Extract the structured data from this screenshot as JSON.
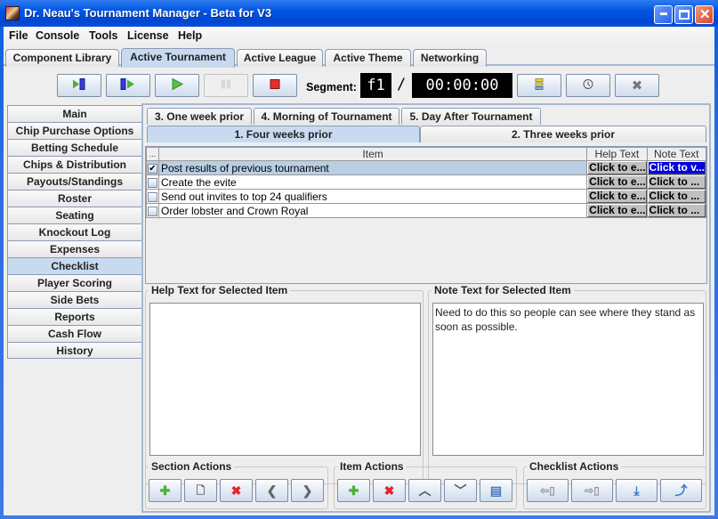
{
  "window": {
    "title": "Dr. Neau's Tournament Manager - Beta for V3",
    "controls": {
      "minimize": "_",
      "maximize": "□",
      "close": "✕"
    }
  },
  "menubar": [
    "File",
    "Console",
    "Tools",
    "License",
    "Help"
  ],
  "top_tabs": [
    {
      "label": "Component Library",
      "active": false
    },
    {
      "label": "Active Tournament",
      "active": true
    },
    {
      "label": "Active League",
      "active": false
    },
    {
      "label": "Active Theme",
      "active": false
    },
    {
      "label": "Networking",
      "active": false
    }
  ],
  "toolbar": {
    "buttons": [
      {
        "name": "skip-to-start",
        "icon": "▶▮",
        "enabled": true
      },
      {
        "name": "skip-to-next",
        "icon": "▮▶",
        "enabled": true
      },
      {
        "name": "play",
        "icon": "▶",
        "enabled": true
      },
      {
        "name": "pause",
        "icon": "▮▮",
        "enabled": false
      },
      {
        "name": "stop",
        "icon": "■",
        "enabled": true
      }
    ],
    "segment_label": "Segment:",
    "segment_value": "f1",
    "separator": "/",
    "timer": "00:00:00",
    "right_buttons": [
      {
        "name": "levels",
        "icon": "≣"
      },
      {
        "name": "clock",
        "icon": "◷"
      },
      {
        "name": "close",
        "icon": "✖"
      }
    ]
  },
  "side_tabs": [
    {
      "label": "Main",
      "active": false
    },
    {
      "label": "Chip Purchase Options",
      "active": false
    },
    {
      "label": "Betting Schedule",
      "active": false
    },
    {
      "label": "Chips & Distribution",
      "active": false
    },
    {
      "label": "Payouts/Standings",
      "active": false
    },
    {
      "label": "Roster",
      "active": false
    },
    {
      "label": "Seating",
      "active": false
    },
    {
      "label": "Knockout Log",
      "active": false
    },
    {
      "label": "Expenses",
      "active": false
    },
    {
      "label": "Checklist",
      "active": true
    },
    {
      "label": "Player Scoring",
      "active": false
    },
    {
      "label": "Side Bets",
      "active": false
    },
    {
      "label": "Reports",
      "active": false
    },
    {
      "label": "Cash Flow",
      "active": false
    },
    {
      "label": "History",
      "active": false
    }
  ],
  "section_tabs": {
    "row_back": [
      "3. One week prior",
      "4. Morning of Tournament",
      "5. Day After Tournament"
    ],
    "row_front": [
      {
        "label": "1. Four weeks prior",
        "active": true
      },
      {
        "label": "2. Three weeks prior",
        "active": false
      }
    ]
  },
  "checklist_table": {
    "columns": [
      "...",
      "Item",
      "Help Text",
      "Note Text"
    ],
    "rows": [
      {
        "checked": true,
        "item": "Post results of previous tournament",
        "help": "Click to e...",
        "note": "Click to v...",
        "selected": true
      },
      {
        "checked": false,
        "item": "Create the evite",
        "help": "Click to e...",
        "note": "Click to ...",
        "selected": false
      },
      {
        "checked": false,
        "item": "Send out invites to top 24 qualifiers",
        "help": "Click to e...",
        "note": "Click to ...",
        "selected": false
      },
      {
        "checked": false,
        "item": "Order lobster and Crown Royal",
        "help": "Click to e...",
        "note": "Click to ...",
        "selected": false
      }
    ]
  },
  "help_panel": {
    "title": "Help Text for Selected Item",
    "text": ""
  },
  "note_panel": {
    "title": "Note Text for Selected Item",
    "text": "Need to do this so people can see where they stand as soon as possible."
  },
  "section_actions": {
    "title": "Section Actions",
    "buttons": [
      {
        "name": "add-section",
        "icon": "✚"
      },
      {
        "name": "edit-section",
        "icon": "🗋"
      },
      {
        "name": "delete-section",
        "icon": "✖"
      },
      {
        "name": "move-section-left",
        "icon": "❮"
      },
      {
        "name": "move-section-right",
        "icon": "❯"
      }
    ]
  },
  "item_actions": {
    "title": "Item Actions",
    "buttons": [
      {
        "name": "add-item",
        "icon": "✚"
      },
      {
        "name": "delete-item",
        "icon": "✖"
      },
      {
        "name": "move-item-up",
        "icon": "︿"
      },
      {
        "name": "move-item-down",
        "icon": "﹀"
      },
      {
        "name": "copy-item",
        "icon": "▤"
      }
    ]
  },
  "checklist_actions": {
    "title": "Checklist Actions",
    "buttons": [
      {
        "name": "export-checklist",
        "icon": "⇦▯"
      },
      {
        "name": "import-checklist",
        "icon": "⇨▯"
      },
      {
        "name": "load-checklist",
        "icon": "⤓"
      },
      {
        "name": "save-checklist",
        "icon": "⤴"
      }
    ]
  },
  "colors": {
    "titlebar": "#0055e3",
    "active_tab": "#c8daf0",
    "selected_row": "#b8cfe5",
    "highlight_cell": "#0000e0",
    "add_icon": "#4cae3c",
    "delete_icon": "#e02828"
  }
}
